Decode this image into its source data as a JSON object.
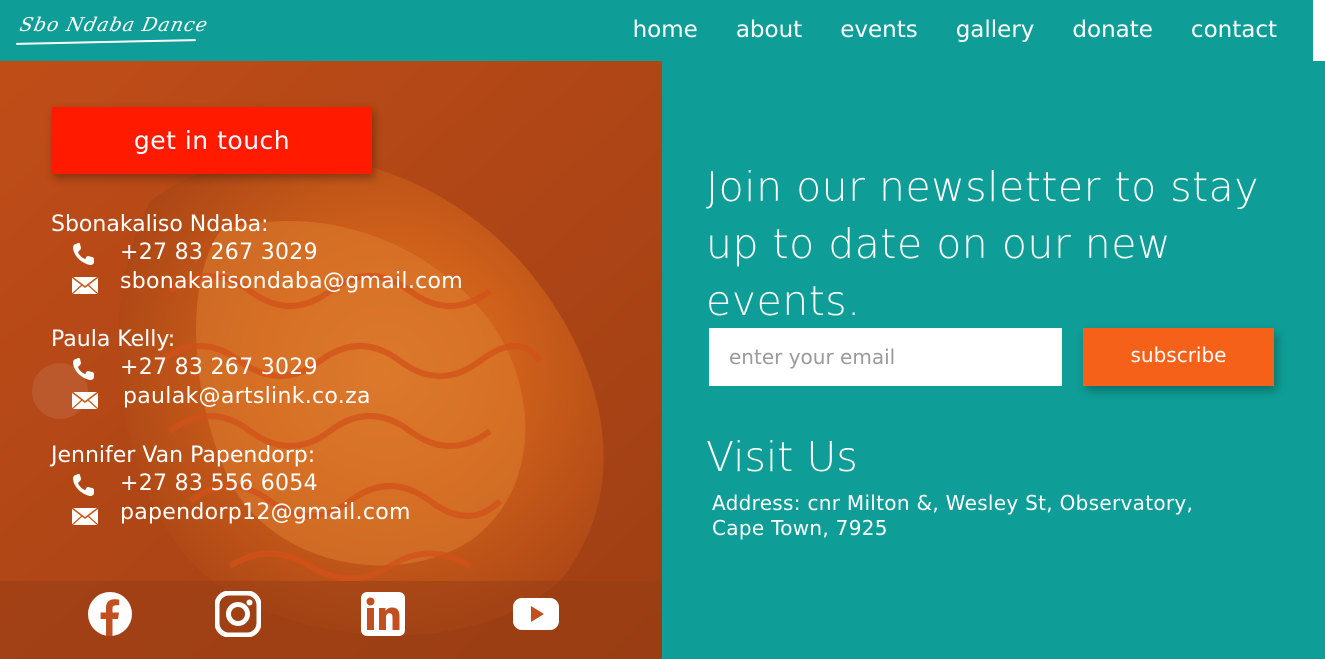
{
  "brand": {
    "logo_text": "Sbo Ndaba Dance"
  },
  "nav": {
    "items": [
      {
        "label": "home"
      },
      {
        "label": "about"
      },
      {
        "label": "events"
      },
      {
        "label": "gallery"
      },
      {
        "label": "donate"
      },
      {
        "label": "contact"
      }
    ]
  },
  "left": {
    "cta_label": "get in touch",
    "contacts": [
      {
        "name": "Sbonakaliso Ndaba:",
        "phone": "+27 83 267 3029",
        "email": "sbonakalisondaba@gmail.com"
      },
      {
        "name": "Paula Kelly:",
        "phone": "+27 83 267 3029",
        "email": "paulak@artslink.co.za"
      },
      {
        "name": "Jennifer Van Papendorp:",
        "phone": "+27 83 556 6054",
        "email": "papendorp12@gmail.com"
      }
    ],
    "socials": [
      {
        "icon": "facebook-icon"
      },
      {
        "icon": "instagram-icon"
      },
      {
        "icon": "linkedin-icon"
      },
      {
        "icon": "youtube-icon"
      }
    ]
  },
  "right": {
    "newsletter_heading": "Join our newsletter to stay up to date on our new events.",
    "email_placeholder": "enter your email",
    "subscribe_label": "subscribe",
    "visit_heading": "Visit Us",
    "address": "Address: cnr Milton &, Wesley St, Observatory, Cape Town, 7925"
  },
  "colors": {
    "teal": "#0e9e97",
    "cta_red": "#ff1a00",
    "subscribe_orange": "#f56119",
    "overlay_orange": "#c9561a"
  }
}
